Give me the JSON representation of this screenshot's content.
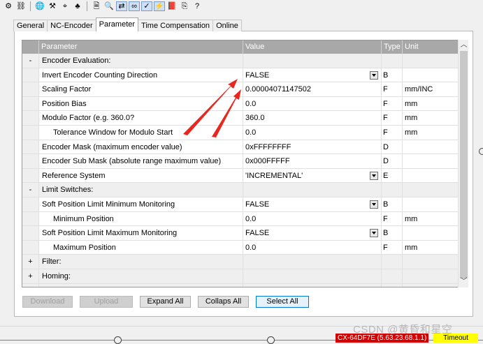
{
  "toolbar": {
    "buttons": [
      {
        "icon": "settings-tools-icon",
        "glyph": "⚙"
      },
      {
        "icon": "network-icon",
        "glyph": "⛓"
      },
      {
        "icon": "globe-tree-icon",
        "glyph": "🌐"
      },
      {
        "icon": "grid-tools-icon",
        "glyph": "⚒"
      },
      {
        "icon": "scope-icon",
        "glyph": "⌖"
      },
      {
        "icon": "tree-icon",
        "glyph": "♣"
      },
      {
        "icon": "document-icon",
        "glyph": "🗎"
      },
      {
        "icon": "search-icon",
        "glyph": "🔍"
      },
      {
        "icon": "link-variable-icon",
        "glyph": "⇄"
      },
      {
        "icon": "glasses-icon",
        "glyph": "∞"
      },
      {
        "icon": "toggle-check-icon",
        "glyph": "✓"
      },
      {
        "icon": "force-icon",
        "glyph": "⚡"
      },
      {
        "icon": "book-icon",
        "glyph": "📕"
      },
      {
        "icon": "copy-icon",
        "glyph": "⎘"
      },
      {
        "icon": "help-icon",
        "glyph": "?"
      }
    ]
  },
  "tabs": [
    "General",
    "NC-Encoder",
    "Parameter",
    "Time Compensation",
    "Online"
  ],
  "active_tab": "Parameter",
  "grid": {
    "headers": [
      "",
      "Parameter",
      "Value",
      "Type",
      "Unit"
    ],
    "rows": [
      {
        "expander": "-",
        "name": "Encoder Evaluation:",
        "value": "",
        "type": "",
        "unit": "",
        "group": true
      },
      {
        "expander": "",
        "name": "Invert Encoder Counting Direction",
        "value": "FALSE",
        "type": "B",
        "unit": "",
        "dropdown": true
      },
      {
        "expander": "",
        "name": "Scaling Factor",
        "value": "0.00004071147502",
        "type": "F",
        "unit": "mm/INC"
      },
      {
        "expander": "",
        "name": "Position Bias",
        "value": "0.0",
        "type": "F",
        "unit": "mm"
      },
      {
        "expander": "",
        "name": "Modulo Factor (e.g. 360.0?",
        "value": "360.0",
        "type": "F",
        "unit": "mm"
      },
      {
        "expander": "",
        "name": "Tolerance Window for Modulo Start",
        "value": "0.0",
        "type": "F",
        "unit": "mm",
        "indent": true
      },
      {
        "expander": "",
        "name": "Encoder Mask (maximum encoder value)",
        "value": "0xFFFFFFFF",
        "type": "D",
        "unit": ""
      },
      {
        "expander": "",
        "name": "Encoder Sub Mask (absolute range maximum value)",
        "value": "0x000FFFFF",
        "type": "D",
        "unit": ""
      },
      {
        "expander": "",
        "name": "Reference System",
        "value": "'INCREMENTAL'",
        "type": "E",
        "unit": "",
        "dropdown": true
      },
      {
        "expander": "-",
        "name": "Limit Switches:",
        "value": "",
        "type": "",
        "unit": "",
        "group": true
      },
      {
        "expander": "",
        "name": "Soft Position Limit Minimum Monitoring",
        "value": "FALSE",
        "type": "B",
        "unit": "",
        "dropdown": true
      },
      {
        "expander": "",
        "name": "Minimum Position",
        "value": "0.0",
        "type": "F",
        "unit": "mm",
        "indent": true
      },
      {
        "expander": "",
        "name": "Soft Position Limit Maximum Monitoring",
        "value": "FALSE",
        "type": "B",
        "unit": "",
        "dropdown": true
      },
      {
        "expander": "",
        "name": "Maximum Position",
        "value": "0.0",
        "type": "F",
        "unit": "mm",
        "indent": true
      },
      {
        "expander": "+",
        "name": "Filter:",
        "value": "",
        "type": "",
        "unit": "",
        "group": true
      },
      {
        "expander": "+",
        "name": "Homing:",
        "value": "",
        "type": "",
        "unit": "",
        "group": true
      },
      {
        "expander": "",
        "name": "",
        "value": "",
        "type": "",
        "unit": "",
        "group": true
      }
    ]
  },
  "buttons": {
    "download": "Download",
    "upload": "Upload",
    "expand_all": "Expand All",
    "collapse_all": "Collaps All",
    "select_all": "Select All"
  },
  "status": {
    "target": "CX-64DF7E (5.63.23.68.1.1)",
    "timeout": "Timeout",
    "target_color": "#d40000",
    "timeout_color": "#ffff00"
  },
  "watermark": "CSDN @黄昏和星空",
  "annotation_color": "#e8281e"
}
